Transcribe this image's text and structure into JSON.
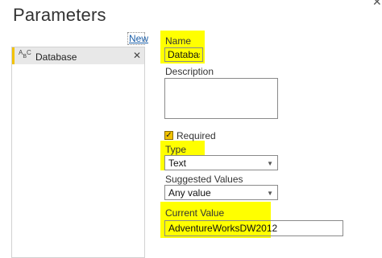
{
  "window": {
    "title": "Parameters"
  },
  "sidebar": {
    "new_label": "New",
    "items": [
      {
        "label": "Database",
        "type_icon": "abc-text-icon",
        "selected": true
      }
    ]
  },
  "form": {
    "name_label": "Name",
    "name_value": "Database",
    "description_label": "Description",
    "description_value": "",
    "required_label": "Required",
    "required_checked": true,
    "type_label": "Type",
    "type_value": "Text",
    "suggested_label": "Suggested Values",
    "suggested_value": "Any value",
    "current_label": "Current Value",
    "current_value": "AdventureWorksDW2012"
  },
  "colors": {
    "highlight": "#ffff00",
    "accent": "#f2c200",
    "link": "#1a5ea8"
  }
}
